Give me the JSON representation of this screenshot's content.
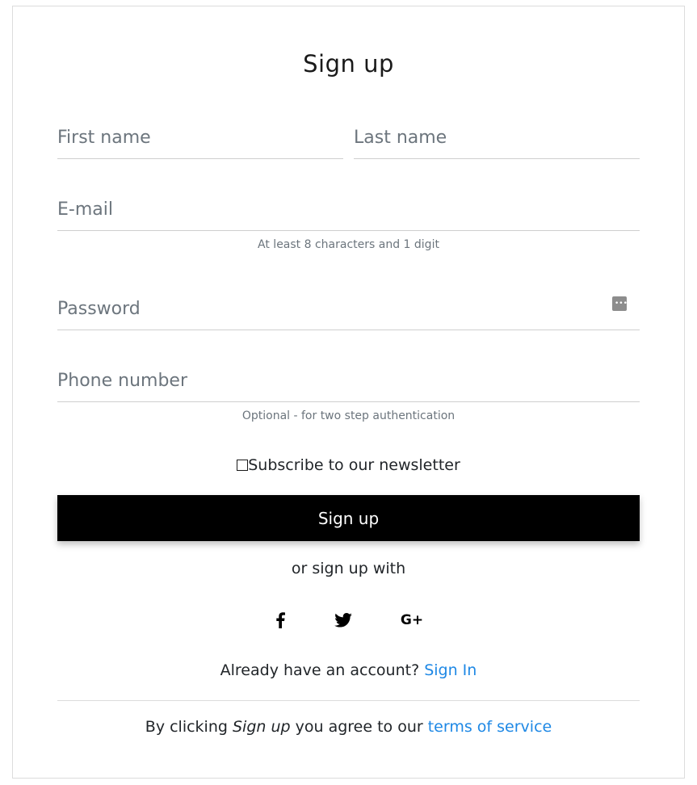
{
  "title": "Sign up",
  "fields": {
    "first_name": {
      "placeholder": "First name",
      "value": ""
    },
    "last_name": {
      "placeholder": "Last name",
      "value": ""
    },
    "email": {
      "placeholder": "E-mail",
      "value": ""
    },
    "email_hint": "At least 8 characters and 1 digit",
    "password": {
      "placeholder": "Password",
      "value": ""
    },
    "phone": {
      "placeholder": "Phone number",
      "value": ""
    },
    "phone_hint": "Optional - for two step authentication"
  },
  "newsletter": {
    "label": "Subscribe to our newsletter",
    "checked": false
  },
  "submit_label": "Sign up",
  "or_text": "or sign up with",
  "social": [
    {
      "icon": "facebook-icon",
      "glyph": "f"
    },
    {
      "icon": "twitter-icon",
      "glyph": "t"
    },
    {
      "icon": "google-plus-icon",
      "glyph": "G+"
    }
  ],
  "signin": {
    "prompt": "Already have an account?",
    "link": "Sign In"
  },
  "terms": {
    "prefix": "By clicking",
    "emphasis": "Sign up",
    "middle": "you agree to our",
    "link": "terms of service"
  },
  "colors": {
    "link": "#1e88e5",
    "button_bg": "#000000",
    "button_text": "#ffffff"
  }
}
